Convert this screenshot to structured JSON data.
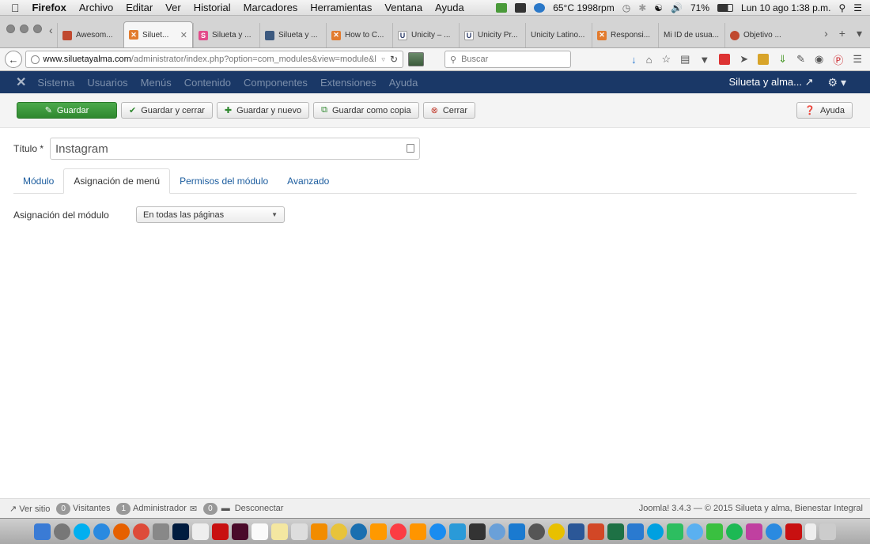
{
  "macmenu": {
    "app": "Firefox",
    "items": [
      "Archivo",
      "Editar",
      "Ver",
      "Historial",
      "Marcadores",
      "Herramientas",
      "Ventana",
      "Ayuda"
    ],
    "temp": "65°C 1998rpm",
    "battery": "71%",
    "clock": "Lun 10 ago  1:38 p.m."
  },
  "tabs": [
    {
      "title": "Awesom...",
      "color": "#c0492f"
    },
    {
      "title": "Siluet...",
      "color": "#e27b2e",
      "active": true
    },
    {
      "title": "Silueta y ...",
      "color": "#e24b8a"
    },
    {
      "title": "Silueta y ...",
      "color": "#3d5a80"
    },
    {
      "title": "How to C...",
      "color": "#e27b2e"
    },
    {
      "title": "Unicity – ...",
      "color": "#2b3a67"
    },
    {
      "title": "Unicity Pr...",
      "color": "#2b3a67"
    },
    {
      "title": "Unicity Latino...",
      "color": "#cccccc"
    },
    {
      "title": "Responsi...",
      "color": "#e27b2e"
    },
    {
      "title": "Mi ID de usua...",
      "color": "#cccccc"
    },
    {
      "title": "Objetivo ...",
      "color": "#c0492f"
    }
  ],
  "browser": {
    "url_domain": "www.siluetayalma.com",
    "url_path": "/administrator/index.php?option=com_modules&view=module&layo",
    "search_placeholder": "Buscar"
  },
  "joomla_menu": {
    "items": [
      "Sistema",
      "Usuarios",
      "Menús",
      "Contenido",
      "Componentes",
      "Extensiones",
      "Ayuda"
    ],
    "site": "Silueta y alma..."
  },
  "toolbar": {
    "save": "Guardar",
    "save_close": "Guardar y cerrar",
    "save_new": "Guardar y nuevo",
    "save_copy": "Guardar como copia",
    "close": "Cerrar",
    "help": "Ayuda"
  },
  "form": {
    "title_label": "Título *",
    "title_value": "Instagram",
    "tabs": [
      "Módulo",
      "Asignación de menú",
      "Permisos del módulo",
      "Avanzado"
    ],
    "active_tab": 1,
    "assign_label": "Asignación del módulo",
    "assign_value": "En todas las páginas"
  },
  "status": {
    "view_site": "Ver sitio",
    "visitors_count": "0",
    "visitors_label": "Visitantes",
    "admin_count": "1",
    "admin_label": "Administrador",
    "messages_count": "0",
    "logout": "Desconectar",
    "footer": "Joomla! 3.4.3  —  © 2015 Silueta y alma, Bienestar Integral"
  }
}
